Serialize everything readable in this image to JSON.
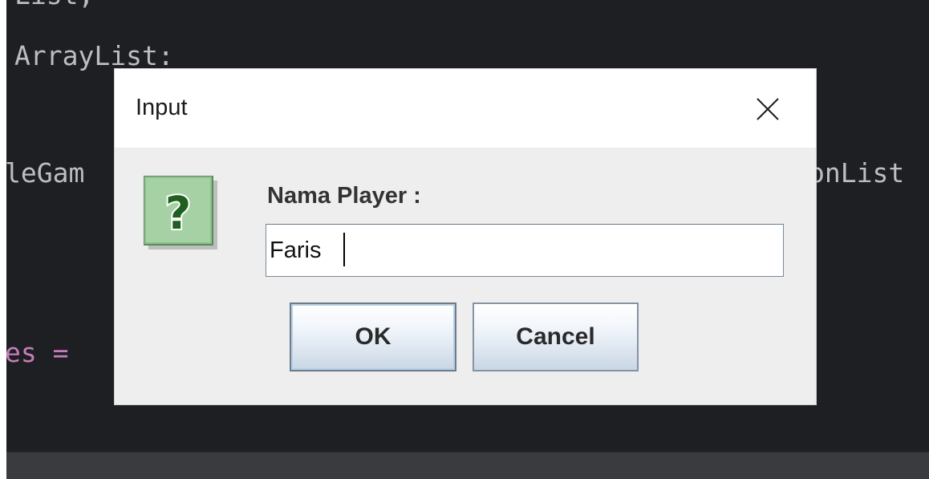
{
  "editor": {
    "line_top_cut": "List;",
    "line_arraylist": "ArrayList:",
    "line_left_partial": "leGam",
    "line_right_partial": "onList",
    "line_es": "es =",
    "colors": {
      "background": "#1e1f22",
      "text": "#bcbec4",
      "keyword_purple": "#c77dbb"
    }
  },
  "dialog": {
    "title": "Input",
    "close_icon": "close-x-icon",
    "message_icon": "question-mark-icon",
    "prompt_label": "Nama Player :",
    "input_value": "Faris",
    "buttons": {
      "ok_label": "OK",
      "cancel_label": "Cancel"
    },
    "colors": {
      "titlebar": "#ffffff",
      "body": "#eeeeee",
      "icon_green": "#9fcc9f",
      "icon_question": "#1f5f1f"
    }
  }
}
